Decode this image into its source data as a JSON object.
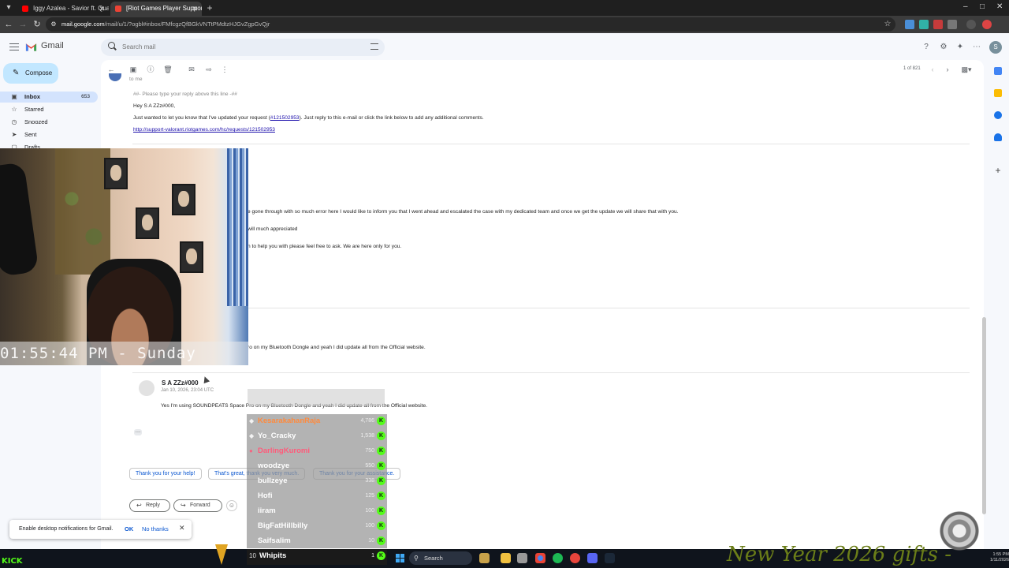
{
  "browser": {
    "tabs": [
      {
        "label": "Iggy Azalea - Savior ft. Quavo",
        "favicon_color": "#ff0000",
        "active": false
      },
      {
        "label": "[Riot Games Player Support] Re",
        "favicon_color": "#ea4335",
        "active": true
      }
    ],
    "url_host": "mail.google.com",
    "url_path": "/mail/u/1/?ogbl#inbox/FMfcgzQfBGkVNTtPMdtzHJGvZgpGvQjr"
  },
  "gmail": {
    "logo_text": "Gmail",
    "search_placeholder": "Search mail",
    "compose_label": "Compose",
    "nav": [
      {
        "label": "Inbox",
        "count": "653",
        "icon": "inbox-icon"
      },
      {
        "label": "Starred",
        "count": "",
        "icon": "star-icon"
      },
      {
        "label": "Snoozed",
        "count": "",
        "icon": "clock-icon"
      },
      {
        "label": "Sent",
        "count": "",
        "icon": "send-icon"
      },
      {
        "label": "Drafts",
        "count": "",
        "icon": "draft-icon"
      }
    ],
    "avatar_letter": "S",
    "pager": "1 of 821"
  },
  "thread": {
    "to_me": "to me",
    "reply_marker": "##- Please type your reply above this line -##",
    "greeting": "Hey S A ZZz#000,",
    "update_text_1": "Just wanted to let you know that I've updated your request (",
    "ticket_number": "#121502953",
    "update_text_2": "). Just reply to this e-mail or click the link below to add any additional comments.",
    "ticket_link": "http://support-valorant.riotgames.com/hc/requests/121502953",
    "agent_line_1": "e gone through with so much error here I would like to inform you that I went ahead and escalated the case with my dedicated team and once we get the update we will share that with you.",
    "agent_line_2": "will much appreciated",
    "agent_line_3": "n to help you with please feel free to ask. We are here only for you.",
    "collapsed_reply": "ro on my Bluetooth Dongle and yeah I did update all from the Official website.",
    "sender_name": "S A ZZz#000",
    "sender_date": "Jan 10, 2026, 23:04 UTC",
    "last_message": "Yes I'm using SOUNDPEATS Space Pro on my Bluetooth Dongle and yeah I did update all from the Official website.",
    "smart_replies": [
      "Thank you for your help!",
      "That's great, thank you very much.",
      "Thank you for your assistance."
    ],
    "reply_label": "Reply",
    "forward_label": "Forward"
  },
  "notification": {
    "text": "Enable desktop notifications for Gmail.",
    "ok": "OK",
    "no_thanks": "No thanks"
  },
  "stream": {
    "clock_overlay": "01:55:44 PM - Sunday",
    "leaderboard": [
      {
        "rank": "",
        "name": "KesarakahanRaja",
        "count": "4,786",
        "color": "#ff8a3d"
      },
      {
        "rank": "",
        "name": "Yo_Cracky",
        "count": "1,538",
        "color": "#ffffff"
      },
      {
        "rank": "",
        "name": "DarlingKuromi",
        "count": "750",
        "color": "#ff5a7a"
      },
      {
        "rank": "",
        "name": "woodzye",
        "count": "550",
        "color": "#ffffff"
      },
      {
        "rank": "",
        "name": "bullzeye",
        "count": "338",
        "color": "#ffffff"
      },
      {
        "rank": "",
        "name": "Hofi",
        "count": "125",
        "color": "#ffffff"
      },
      {
        "rank": "",
        "name": "iiram",
        "count": "100",
        "color": "#ffffff"
      },
      {
        "rank": "",
        "name": "BigFatHillbilly",
        "count": "100",
        "color": "#ffffff"
      },
      {
        "rank": "",
        "name": "Saifsalim",
        "count": "10",
        "color": "#ffffff"
      },
      {
        "rank": "10",
        "name": "Whipits",
        "count": "1",
        "color": "#ffffff"
      }
    ],
    "kick_label": "KICK",
    "banner": "New Year 2026 gifts -"
  },
  "taskbar": {
    "search_label": "Search",
    "time": "1:55 PM",
    "date": "1/11/2026"
  }
}
